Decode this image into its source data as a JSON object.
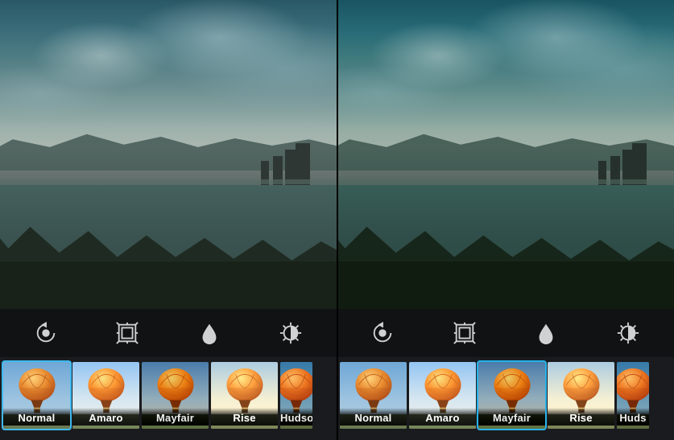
{
  "panes": [
    {
      "id": "left",
      "selected_filter_index": 0,
      "tools": [
        {
          "name": "rotate-straighten",
          "icon": "rotate-icon"
        },
        {
          "name": "frame-toggle",
          "icon": "frame-icon"
        },
        {
          "name": "tilt-shift-blur",
          "icon": "drop-icon"
        },
        {
          "name": "lux-contrast",
          "icon": "contrast-icon"
        }
      ],
      "filters": [
        {
          "key": "normal",
          "label": "Normal"
        },
        {
          "key": "amaro",
          "label": "Amaro"
        },
        {
          "key": "mayfair",
          "label": "Mayfair"
        },
        {
          "key": "rise",
          "label": "Rise"
        },
        {
          "key": "hudson",
          "label": "Hudso"
        }
      ]
    },
    {
      "id": "right",
      "selected_filter_index": 2,
      "tools": [
        {
          "name": "rotate-straighten",
          "icon": "rotate-icon"
        },
        {
          "name": "frame-toggle",
          "icon": "frame-icon"
        },
        {
          "name": "tilt-shift-blur",
          "icon": "drop-icon"
        },
        {
          "name": "lux-contrast",
          "icon": "contrast-icon"
        }
      ],
      "filters": [
        {
          "key": "normal",
          "label": "Normal"
        },
        {
          "key": "amaro",
          "label": "Amaro"
        },
        {
          "key": "mayfair",
          "label": "Mayfair"
        },
        {
          "key": "rise",
          "label": "Rise"
        },
        {
          "key": "hudson",
          "label": "Huds"
        }
      ]
    }
  ],
  "preview_subject": "cloudy-sky-over-river-city-with-bridge-and-trees"
}
